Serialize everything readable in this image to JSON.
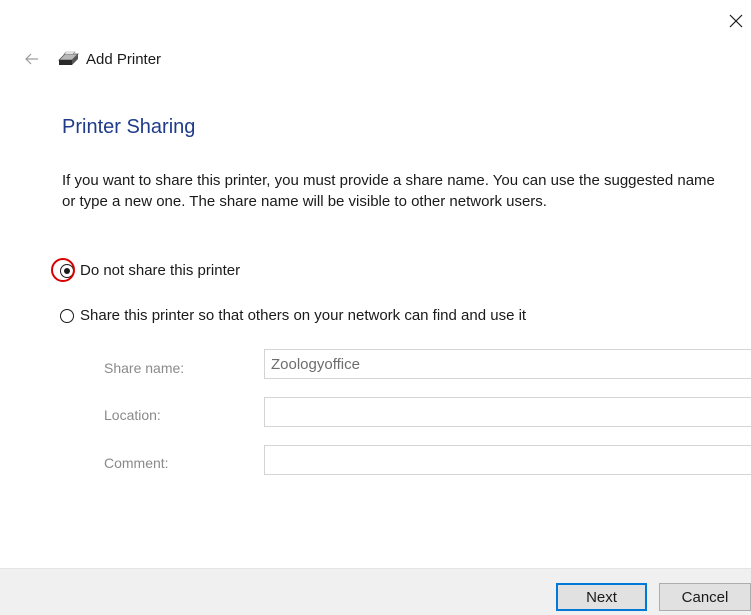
{
  "window": {
    "close_icon": "close-icon"
  },
  "header": {
    "back_icon": "back-arrow-icon",
    "printer_icon": "printer-icon",
    "title": "Add Printer"
  },
  "main": {
    "heading": "Printer Sharing",
    "description": "If you want to share this printer, you must provide a share name. You can use the suggested name or type a new one. The share name will be visible to other network users.",
    "options": [
      {
        "label": "Do not share this printer",
        "selected": true
      },
      {
        "label": "Share this printer so that others on your network can find and use it",
        "selected": false
      }
    ],
    "fields": {
      "share_name": {
        "label": "Share name:",
        "value": "Zoologyoffice"
      },
      "location": {
        "label": "Location:",
        "value": ""
      },
      "comment": {
        "label": "Comment:",
        "value": ""
      }
    }
  },
  "footer": {
    "next_label": "Next",
    "cancel_label": "Cancel"
  },
  "colors": {
    "heading": "#1f3b8a",
    "highlight_ring": "#d80000",
    "primary_border": "#0078d7",
    "footer_bg": "#f0f0f0"
  }
}
